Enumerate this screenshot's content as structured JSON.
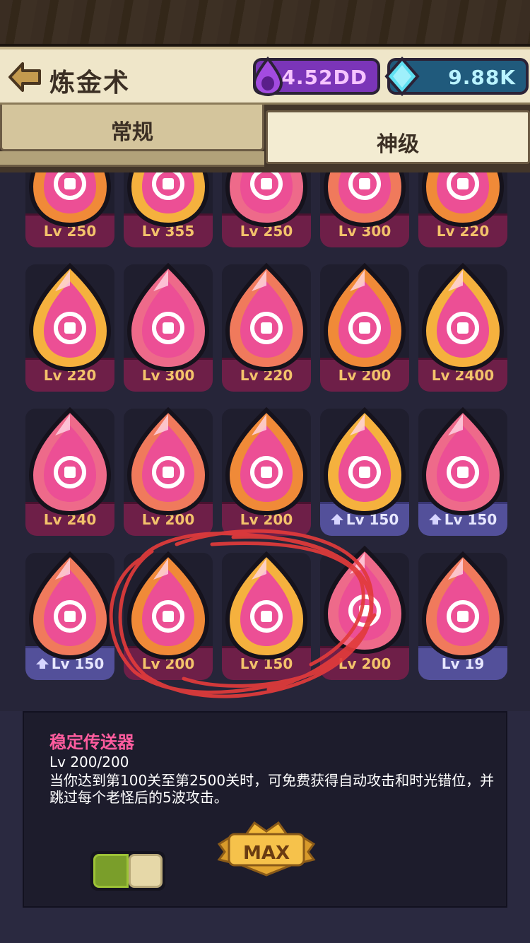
{
  "header": {
    "title": "炼金术",
    "elixir_value": "4.52DD",
    "gem_value": "9.88K"
  },
  "tabs": [
    {
      "label": "常规",
      "active": false
    },
    {
      "label": "神级",
      "active": true
    }
  ],
  "grid": {
    "rows": [
      [
        {
          "level": "Lv 250",
          "icon": "heart-plus-icon",
          "bar": "red"
        },
        {
          "level": "Lv 355",
          "icon": "running-figure-icon",
          "bar": "red"
        },
        {
          "level": "Lv 250",
          "icon": "coins-icon",
          "bar": "red"
        },
        {
          "level": "Lv 300",
          "icon": "heart-hand-icon",
          "bar": "red"
        },
        {
          "level": "Lv 220",
          "icon": "fist-icon",
          "bar": "red"
        }
      ],
      [
        {
          "level": "Lv 220",
          "icon": "hourglass-icon",
          "bar": "red"
        },
        {
          "level": "Lv 300",
          "icon": "cracked-egg-icon",
          "bar": "red"
        },
        {
          "level": "Lv 220",
          "icon": "skull-hourglass-icon",
          "bar": "red"
        },
        {
          "level": "Lv 200",
          "icon": "swirl-icon",
          "bar": "red"
        },
        {
          "level": "Lv 2400",
          "icon": "sparkle-icon",
          "bar": "red"
        }
      ],
      [
        {
          "level": "Lv 240",
          "icon": "diamond-heart-icon",
          "bar": "red"
        },
        {
          "level": "Lv 200",
          "icon": "burst-fist-icon",
          "bar": "red"
        },
        {
          "level": "Lv 200",
          "icon": "broken-heart-eye-icon",
          "bar": "red"
        },
        {
          "level": "Lv 150",
          "icon": "shield-fist-icon",
          "bar": "blue",
          "upgrade": true
        },
        {
          "level": "Lv 150",
          "icon": "shield-crown-icon",
          "bar": "blue",
          "upgrade": true
        }
      ],
      [
        {
          "level": "Lv 150",
          "icon": "shield-crystal-icon",
          "bar": "blue",
          "upgrade": true
        },
        {
          "level": "Lv 200",
          "icon": "scroll-percent-icon",
          "bar": "red"
        },
        {
          "level": "Lv 150",
          "icon": "tombstone-hand-icon",
          "bar": "red"
        },
        {
          "level": "Lv 200",
          "icon": "teleporter-icon",
          "bar": "red",
          "selected": true
        },
        {
          "level": "Lv 19",
          "icon": "sword-stone-icon",
          "bar": "blue"
        }
      ]
    ]
  },
  "info": {
    "name": "稳定传送器",
    "level": "Lv 200/200",
    "description": "当你达到第100关至第2500关时，可免费获得自动攻击和时光错位，并跳过每个老怪后的5波攻击。",
    "max_label": "MAX"
  },
  "colors": {
    "accent_pink": "#ff5c9e",
    "level_gold": "#f3c26b",
    "annotation_red": "#e23b3b"
  }
}
